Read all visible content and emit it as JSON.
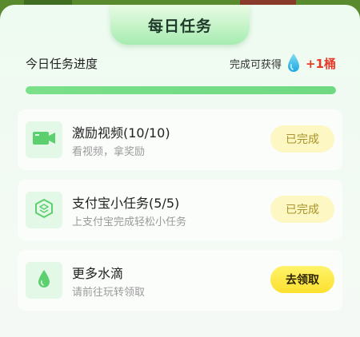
{
  "header": {
    "title": "每日任务"
  },
  "progress": {
    "label": "今日任务进度",
    "reward_text": "完成可获得",
    "reward_amount": "+1桶",
    "fill": 1.0
  },
  "tasks": [
    {
      "title": "激励视频(10/10)",
      "subtitle": "看视频，拿奖励",
      "button": "已完成",
      "icon": "video-icon",
      "status": "done"
    },
    {
      "title": "支付宝小任务(5/5)",
      "subtitle": "上支付宝完成轻松小任务",
      "button": "已完成",
      "icon": "alipay-cube-icon",
      "status": "done"
    },
    {
      "title": "更多水滴",
      "subtitle": "请前往玩转领取",
      "button": "去领取",
      "icon": "water-drop-icon",
      "status": "available"
    }
  ],
  "colors": {
    "accent_green": "#6fd982",
    "reward_red": "#e53b2c",
    "button_yellow": "#fde02e",
    "done_button": "#fdf7c3"
  }
}
